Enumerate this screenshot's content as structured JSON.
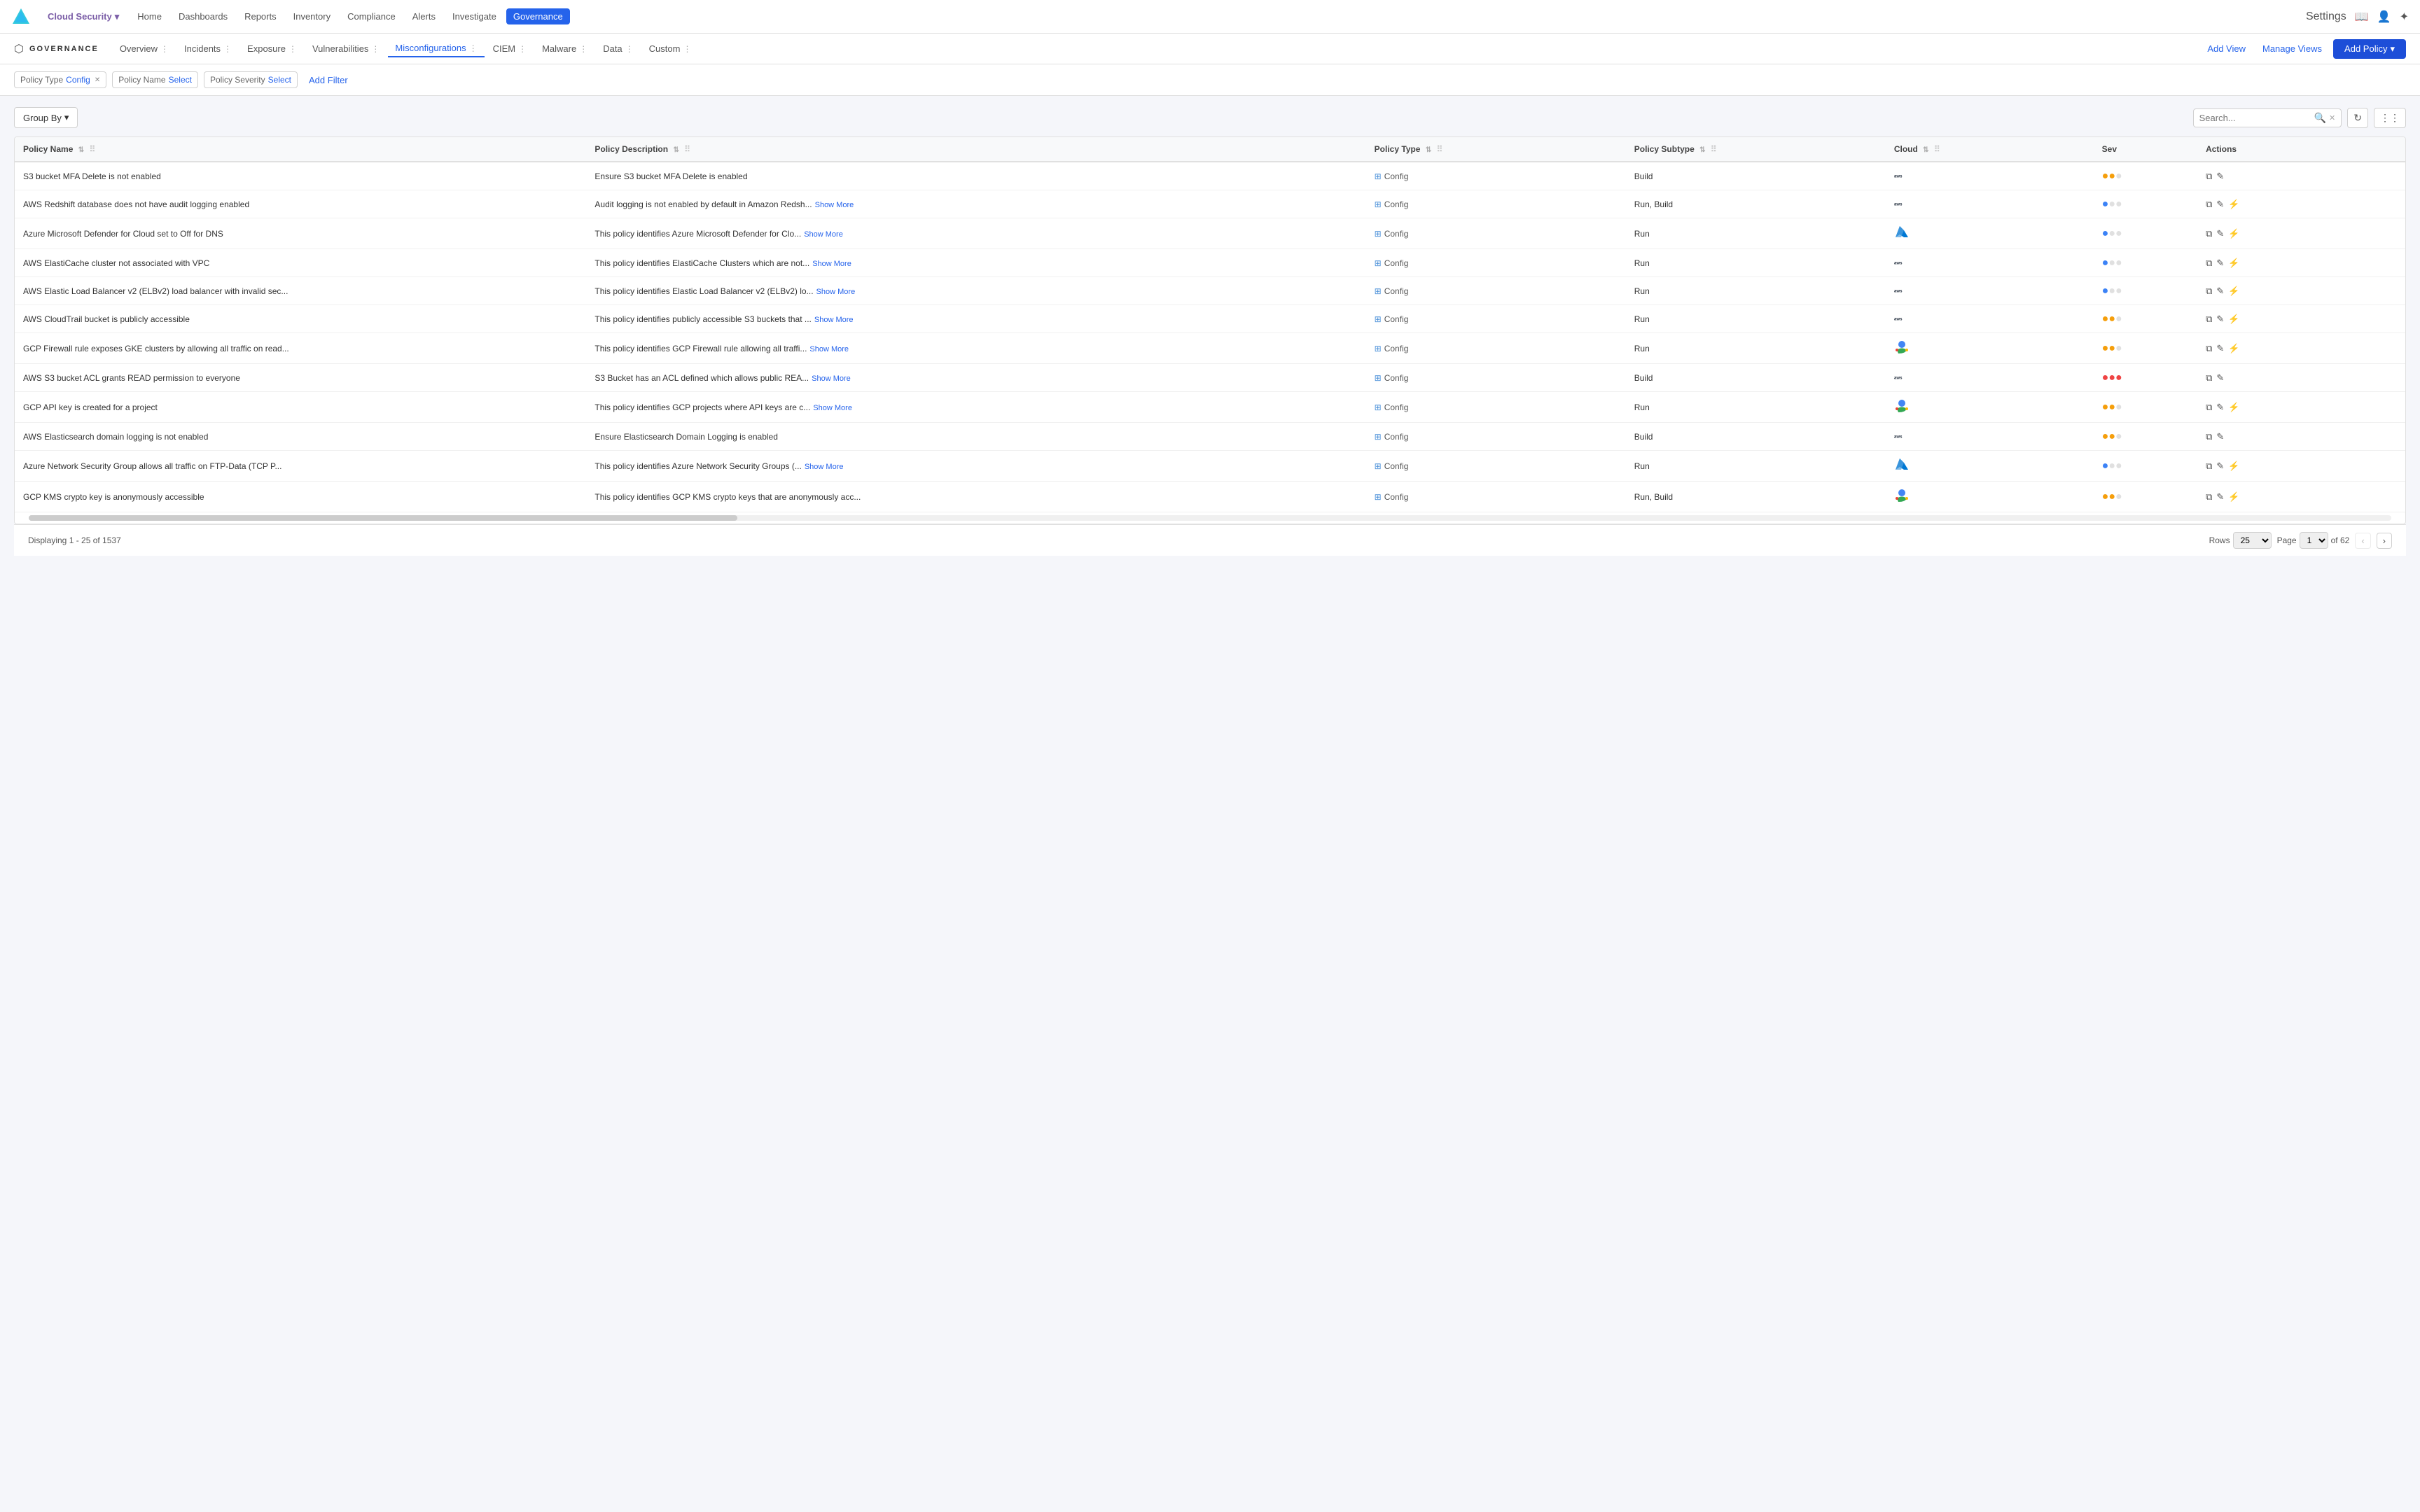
{
  "topNav": {
    "brand": "Cloud Security",
    "brandIcon": "▾",
    "items": [
      "Home",
      "Dashboards",
      "Reports",
      "Inventory",
      "Compliance",
      "Alerts",
      "Investigate",
      "Governance"
    ],
    "activeItem": "Governance",
    "settingsLabel": "Settings",
    "rightIcons": [
      "book-icon",
      "user-icon",
      "help-icon"
    ]
  },
  "subNav": {
    "logoText": "GOVERNANCE",
    "items": [
      "Overview",
      "Incidents",
      "Exposure",
      "Vulnerabilities",
      "Misconfigurations",
      "CIEM",
      "Malware",
      "Data",
      "Custom"
    ],
    "activeItem": "Misconfigurations",
    "addViewLabel": "Add View",
    "manageViewsLabel": "Manage Views",
    "addPolicyLabel": "Add Policy"
  },
  "filters": {
    "chips": [
      {
        "label": "Policy Type",
        "value": "Config",
        "closeable": true
      },
      {
        "label": "Policy Name",
        "value": "Select",
        "closeable": false
      },
      {
        "label": "Policy Severity",
        "value": "Select",
        "closeable": false
      }
    ],
    "addFilterLabel": "Add Filter"
  },
  "toolbar": {
    "groupByLabel": "Group By",
    "searchPlaceholder": "Search...",
    "refreshTitle": "Refresh",
    "columnsTitle": "Columns"
  },
  "table": {
    "columns": [
      {
        "label": "Policy Name",
        "sortable": true
      },
      {
        "label": "Policy Description",
        "sortable": true
      },
      {
        "label": "Policy Type",
        "sortable": true
      },
      {
        "label": "Policy Subtype",
        "sortable": true
      },
      {
        "label": "Cloud",
        "sortable": true
      },
      {
        "label": "Sev",
        "sortable": false
      },
      {
        "label": "Actions",
        "sortable": false
      }
    ],
    "rows": [
      {
        "name": "S3 bucket MFA Delete is not enabled",
        "description": "Ensure S3 bucket MFA Delete is enabled",
        "showMore": false,
        "policyType": "Config",
        "policySubtype": "Build",
        "cloud": "aws",
        "severity": "medium",
        "actions": [
          "copy",
          "edit"
        ]
      },
      {
        "name": "AWS Redshift database does not have audit logging enabled",
        "description": "Audit logging is not enabled by default in Amazon Redsh...",
        "showMore": true,
        "policyType": "Config",
        "policySubtype": "Run, Build",
        "cloud": "aws",
        "severity": "low",
        "actions": [
          "copy",
          "edit",
          "alert"
        ]
      },
      {
        "name": "Azure Microsoft Defender for Cloud set to Off for DNS",
        "description": "This policy identifies Azure Microsoft Defender for Clo...",
        "showMore": true,
        "policyType": "Config",
        "policySubtype": "Run",
        "cloud": "azure",
        "severity": "low",
        "actions": [
          "copy",
          "edit",
          "alert"
        ]
      },
      {
        "name": "AWS ElastiCache cluster not associated with VPC",
        "description": "This policy identifies ElastiCache Clusters which are not...",
        "showMore": true,
        "policyType": "Config",
        "policySubtype": "Run",
        "cloud": "aws",
        "severity": "low",
        "actions": [
          "copy",
          "edit",
          "alert"
        ]
      },
      {
        "name": "AWS Elastic Load Balancer v2 (ELBv2) load balancer with invalid sec...",
        "description": "This policy identifies Elastic Load Balancer v2 (ELBv2) lo...",
        "showMore": true,
        "policyType": "Config",
        "policySubtype": "Run",
        "cloud": "aws",
        "severity": "low",
        "actions": [
          "copy",
          "edit",
          "alert"
        ]
      },
      {
        "name": "AWS CloudTrail bucket is publicly accessible",
        "description": "This policy identifies publicly accessible S3 buckets that ...",
        "showMore": true,
        "policyType": "Config",
        "policySubtype": "Run",
        "cloud": "aws",
        "severity": "medium",
        "actions": [
          "copy",
          "edit",
          "alert"
        ]
      },
      {
        "name": "GCP Firewall rule exposes GKE clusters by allowing all traffic on read...",
        "description": "This policy identifies GCP Firewall rule allowing all traffi...",
        "showMore": true,
        "policyType": "Config",
        "policySubtype": "Run",
        "cloud": "gcp",
        "severity": "medium",
        "actions": [
          "copy",
          "edit",
          "alert"
        ]
      },
      {
        "name": "AWS S3 bucket ACL grants READ permission to everyone",
        "description": "S3 Bucket has an ACL defined which allows public REA...",
        "showMore": true,
        "policyType": "Config",
        "policySubtype": "Build",
        "cloud": "aws",
        "severity": "high",
        "actions": [
          "copy",
          "edit"
        ]
      },
      {
        "name": "GCP API key is created for a project",
        "description": "This policy identifies GCP projects where API keys are c...",
        "showMore": true,
        "policyType": "Config",
        "policySubtype": "Run",
        "cloud": "gcp",
        "severity": "medium",
        "actions": [
          "copy",
          "edit",
          "alert"
        ]
      },
      {
        "name": "AWS Elasticsearch domain logging is not enabled",
        "description": "Ensure Elasticsearch Domain Logging is enabled",
        "showMore": false,
        "policyType": "Config",
        "policySubtype": "Build",
        "cloud": "aws",
        "severity": "medium",
        "actions": [
          "copy",
          "edit"
        ]
      },
      {
        "name": "Azure Network Security Group allows all traffic on FTP-Data (TCP P...",
        "description": "This policy identifies Azure Network Security Groups (...",
        "showMore": true,
        "policyType": "Config",
        "policySubtype": "Run",
        "cloud": "azure",
        "severity": "low",
        "actions": [
          "copy",
          "edit",
          "alert"
        ]
      },
      {
        "name": "GCP KMS crypto key is anonymously accessible",
        "description": "This policy identifies GCP KMS crypto keys that are anonymously acc...",
        "showMore": false,
        "policyType": "Config",
        "policySubtype": "Run, Build",
        "cloud": "gcp",
        "severity": "medium",
        "actions": [
          "copy",
          "edit",
          "alert"
        ]
      }
    ]
  },
  "footer": {
    "displayText": "Displaying 1 - 25 of 1537",
    "rowsLabel": "Rows",
    "rowsValue": "25",
    "pageLabel": "Page",
    "pageValue": "1",
    "ofLabel": "of 62"
  }
}
